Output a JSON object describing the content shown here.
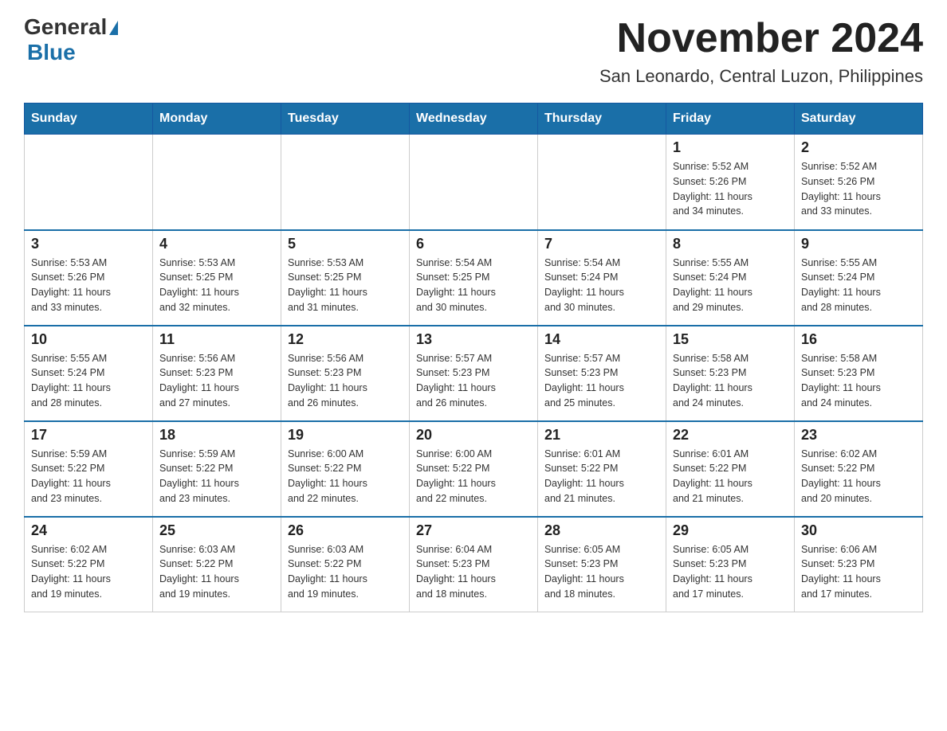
{
  "logo": {
    "general": "General",
    "blue": "Blue",
    "triangle": "▲"
  },
  "title": "November 2024",
  "subtitle": "San Leonardo, Central Luzon, Philippines",
  "days_of_week": [
    "Sunday",
    "Monday",
    "Tuesday",
    "Wednesday",
    "Thursday",
    "Friday",
    "Saturday"
  ],
  "weeks": [
    [
      {
        "day": "",
        "info": ""
      },
      {
        "day": "",
        "info": ""
      },
      {
        "day": "",
        "info": ""
      },
      {
        "day": "",
        "info": ""
      },
      {
        "day": "",
        "info": ""
      },
      {
        "day": "1",
        "info": "Sunrise: 5:52 AM\nSunset: 5:26 PM\nDaylight: 11 hours\nand 34 minutes."
      },
      {
        "day": "2",
        "info": "Sunrise: 5:52 AM\nSunset: 5:26 PM\nDaylight: 11 hours\nand 33 minutes."
      }
    ],
    [
      {
        "day": "3",
        "info": "Sunrise: 5:53 AM\nSunset: 5:26 PM\nDaylight: 11 hours\nand 33 minutes."
      },
      {
        "day": "4",
        "info": "Sunrise: 5:53 AM\nSunset: 5:25 PM\nDaylight: 11 hours\nand 32 minutes."
      },
      {
        "day": "5",
        "info": "Sunrise: 5:53 AM\nSunset: 5:25 PM\nDaylight: 11 hours\nand 31 minutes."
      },
      {
        "day": "6",
        "info": "Sunrise: 5:54 AM\nSunset: 5:25 PM\nDaylight: 11 hours\nand 30 minutes."
      },
      {
        "day": "7",
        "info": "Sunrise: 5:54 AM\nSunset: 5:24 PM\nDaylight: 11 hours\nand 30 minutes."
      },
      {
        "day": "8",
        "info": "Sunrise: 5:55 AM\nSunset: 5:24 PM\nDaylight: 11 hours\nand 29 minutes."
      },
      {
        "day": "9",
        "info": "Sunrise: 5:55 AM\nSunset: 5:24 PM\nDaylight: 11 hours\nand 28 minutes."
      }
    ],
    [
      {
        "day": "10",
        "info": "Sunrise: 5:55 AM\nSunset: 5:24 PM\nDaylight: 11 hours\nand 28 minutes."
      },
      {
        "day": "11",
        "info": "Sunrise: 5:56 AM\nSunset: 5:23 PM\nDaylight: 11 hours\nand 27 minutes."
      },
      {
        "day": "12",
        "info": "Sunrise: 5:56 AM\nSunset: 5:23 PM\nDaylight: 11 hours\nand 26 minutes."
      },
      {
        "day": "13",
        "info": "Sunrise: 5:57 AM\nSunset: 5:23 PM\nDaylight: 11 hours\nand 26 minutes."
      },
      {
        "day": "14",
        "info": "Sunrise: 5:57 AM\nSunset: 5:23 PM\nDaylight: 11 hours\nand 25 minutes."
      },
      {
        "day": "15",
        "info": "Sunrise: 5:58 AM\nSunset: 5:23 PM\nDaylight: 11 hours\nand 24 minutes."
      },
      {
        "day": "16",
        "info": "Sunrise: 5:58 AM\nSunset: 5:23 PM\nDaylight: 11 hours\nand 24 minutes."
      }
    ],
    [
      {
        "day": "17",
        "info": "Sunrise: 5:59 AM\nSunset: 5:22 PM\nDaylight: 11 hours\nand 23 minutes."
      },
      {
        "day": "18",
        "info": "Sunrise: 5:59 AM\nSunset: 5:22 PM\nDaylight: 11 hours\nand 23 minutes."
      },
      {
        "day": "19",
        "info": "Sunrise: 6:00 AM\nSunset: 5:22 PM\nDaylight: 11 hours\nand 22 minutes."
      },
      {
        "day": "20",
        "info": "Sunrise: 6:00 AM\nSunset: 5:22 PM\nDaylight: 11 hours\nand 22 minutes."
      },
      {
        "day": "21",
        "info": "Sunrise: 6:01 AM\nSunset: 5:22 PM\nDaylight: 11 hours\nand 21 minutes."
      },
      {
        "day": "22",
        "info": "Sunrise: 6:01 AM\nSunset: 5:22 PM\nDaylight: 11 hours\nand 21 minutes."
      },
      {
        "day": "23",
        "info": "Sunrise: 6:02 AM\nSunset: 5:22 PM\nDaylight: 11 hours\nand 20 minutes."
      }
    ],
    [
      {
        "day": "24",
        "info": "Sunrise: 6:02 AM\nSunset: 5:22 PM\nDaylight: 11 hours\nand 19 minutes."
      },
      {
        "day": "25",
        "info": "Sunrise: 6:03 AM\nSunset: 5:22 PM\nDaylight: 11 hours\nand 19 minutes."
      },
      {
        "day": "26",
        "info": "Sunrise: 6:03 AM\nSunset: 5:22 PM\nDaylight: 11 hours\nand 19 minutes."
      },
      {
        "day": "27",
        "info": "Sunrise: 6:04 AM\nSunset: 5:23 PM\nDaylight: 11 hours\nand 18 minutes."
      },
      {
        "day": "28",
        "info": "Sunrise: 6:05 AM\nSunset: 5:23 PM\nDaylight: 11 hours\nand 18 minutes."
      },
      {
        "day": "29",
        "info": "Sunrise: 6:05 AM\nSunset: 5:23 PM\nDaylight: 11 hours\nand 17 minutes."
      },
      {
        "day": "30",
        "info": "Sunrise: 6:06 AM\nSunset: 5:23 PM\nDaylight: 11 hours\nand 17 minutes."
      }
    ]
  ]
}
